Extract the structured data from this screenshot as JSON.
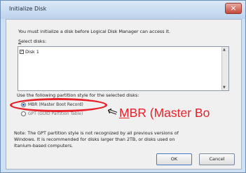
{
  "window": {
    "title": "Initialize Disk"
  },
  "dialog": {
    "intro": "You must initialize a disk before Logical Disk Manager can access it.",
    "select_label": {
      "accesskey": "S",
      "rest": "elect disks:"
    },
    "disks": [
      {
        "label": "Disk 1",
        "checked": true
      }
    ],
    "partition_label": "Use the following partition style for the selected disks:",
    "options": {
      "mbr": "MBR (Master Boot Record)",
      "gpt": "GPT (GUID Partition Table)",
      "selected": "mbr"
    },
    "note": "Note: The GPT partition style is not recognized by all previous versions of\nWindows. It is recommended for disks larger than 2TB, or disks used on\nItanium-based computers.",
    "buttons": {
      "ok": "OK",
      "cancel": "Cancel"
    }
  },
  "annotation": {
    "mark": "M",
    "rest": "BR (Master Bo",
    "color": "#e8202a"
  },
  "icons": {
    "close": "close-icon",
    "pointer": "pointer-icon"
  }
}
